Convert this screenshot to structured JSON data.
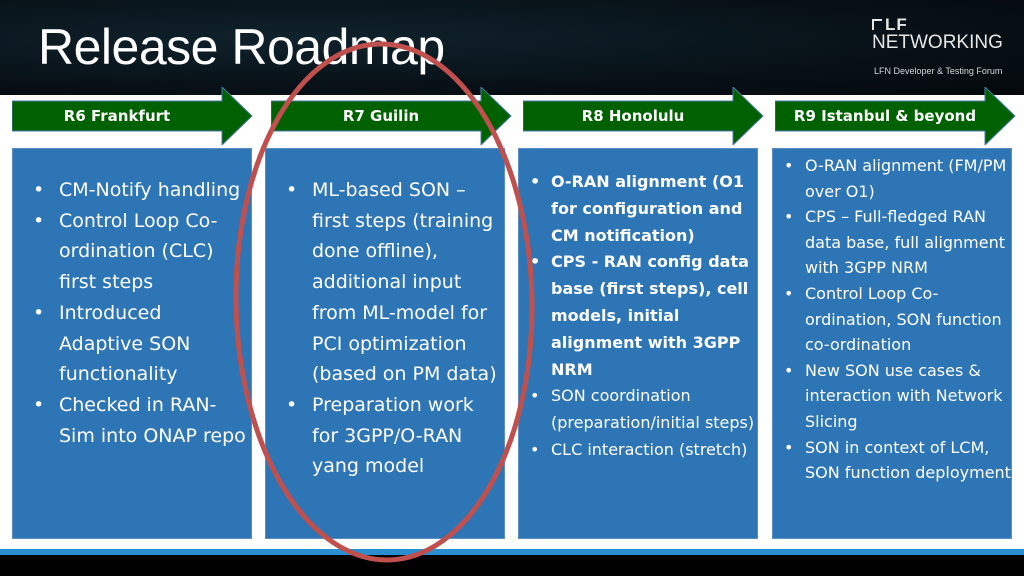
{
  "slide": {
    "title": "Release Roadmap",
    "logo": {
      "brand": "LF",
      "name": "NETWORKING",
      "subtitle": "LFN Developer & Testing Forum"
    }
  },
  "colors": {
    "arrow_fill": "#006100",
    "box_fill": "#2e75b6",
    "highlight_ellipse": "#c0504d",
    "footer_band": "#2a8fd0"
  },
  "releases": [
    {
      "label": "R6 Frankfurt",
      "items": [
        {
          "text": "CM-Notify handling",
          "bold": false
        },
        {
          "text": "Control Loop Co-ordination (CLC) first steps",
          "bold": false
        },
        {
          "text": "Introduced Adaptive SON functionality",
          "bold": false
        },
        {
          "text": "Checked in RAN-Sim into ONAP repo",
          "bold": false
        }
      ]
    },
    {
      "label": "R7 Guilin",
      "highlighted": true,
      "items": [
        {
          "text": "ML-based SON – first steps (training done offline), additional input from ML-model for PCI optimization (based on PM data)",
          "bold": false
        },
        {
          "text": "Preparation work for 3GPP/O-RAN yang model",
          "bold": false
        }
      ]
    },
    {
      "label": "R8 Honolulu",
      "items": [
        {
          "text": "O-RAN alignment (O1 for configuration and CM notification)",
          "bold": true
        },
        {
          "text": "CPS - RAN config data base (first steps), cell models, initial alignment with 3GPP NRM",
          "bold": true
        },
        {
          "text": "SON coordination (preparation/initial steps)",
          "bold": false
        },
        {
          "text": "CLC interaction (stretch)",
          "bold": false
        }
      ]
    },
    {
      "label": "R9 Istanbul & beyond",
      "items": [
        {
          "text": "O-RAN alignment (FM/PM over O1)",
          "bold": false
        },
        {
          "text": "CPS – Full-fledged RAN data base, full alignment with 3GPP NRM",
          "bold": false
        },
        {
          "text": "Control Loop Co-ordination, SON function co-ordination",
          "bold": false
        },
        {
          "text": "New SON use cases & interaction with Network Slicing",
          "bold": false
        },
        {
          "text": "SON in context of LCM, SON function deployment",
          "bold": false
        }
      ]
    }
  ],
  "bullet_glyph": "•"
}
